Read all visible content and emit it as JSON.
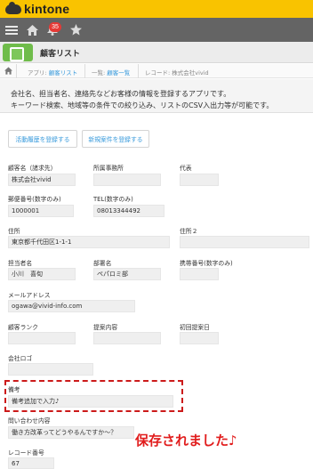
{
  "brand": {
    "name": "kintone"
  },
  "nav": {
    "notification_count": "35"
  },
  "app": {
    "title": "顧客リスト"
  },
  "breadcrumb": {
    "app_prefix": "アプリ: ",
    "app_link": "顧客リスト",
    "list_prefix": "一覧: ",
    "list_link": "顧客一覧",
    "record": "レコード: 株式会社vivid"
  },
  "description": {
    "line1": "会社名、担当者名、連絡先などお客様の情報を登録するアプリです。",
    "line2": "キーワード検索、地域等の条件での絞り込み、リストのCSV入出力等が可能です。"
  },
  "actions": {
    "activity_button": "活動履歴を登録する",
    "deal_button": "新規案件を登録する"
  },
  "fields": {
    "customer_name": {
      "label": "顧客名（諸求先）",
      "value": "株式会社vivid"
    },
    "department": {
      "label": "所属事務所",
      "value": ""
    },
    "representative": {
      "label": "代表",
      "value": ""
    },
    "postal_code": {
      "label": "郵便番号(数字のみ)",
      "value": "1000001"
    },
    "tel": {
      "label": "TEL(数字のみ)",
      "value": "08013344492"
    },
    "address": {
      "label": "住所",
      "value": "東京都千代田区1-1-1"
    },
    "address2": {
      "label": "住所２",
      "value": ""
    },
    "contact_person": {
      "label": "担当者名",
      "value": "小川　喜旬"
    },
    "division": {
      "label": "部署名",
      "value": "ペパロミ部"
    },
    "mobile": {
      "label": "携帯番号(数字のみ)",
      "value": ""
    },
    "email": {
      "label": "メールアドレス",
      "value": "ogawa@vivid-info.com"
    },
    "rank": {
      "label": "顧客ランク",
      "value": ""
    },
    "proposal": {
      "label": "提案内容",
      "value": ""
    },
    "first_proposal_date": {
      "label": "初回提案日",
      "value": ""
    },
    "logo": {
      "label": "会社ロゴ",
      "value": ""
    },
    "notes": {
      "label": "備考",
      "value": "備考追加で入力♪"
    },
    "inquiry": {
      "label": "問い合わせ内容",
      "value": "働き方改革ってどうやるんですか～？"
    },
    "record_number": {
      "label": "レコード番号",
      "value": "67"
    }
  },
  "overlay": {
    "saved_message": "保存されました♪",
    "highlight_color": "#cc1a1a"
  },
  "colors": {
    "brand_yellow": "#f9c300",
    "nav_gray": "#646464",
    "link_blue": "#3498db",
    "app_green": "#6fbc4a"
  }
}
